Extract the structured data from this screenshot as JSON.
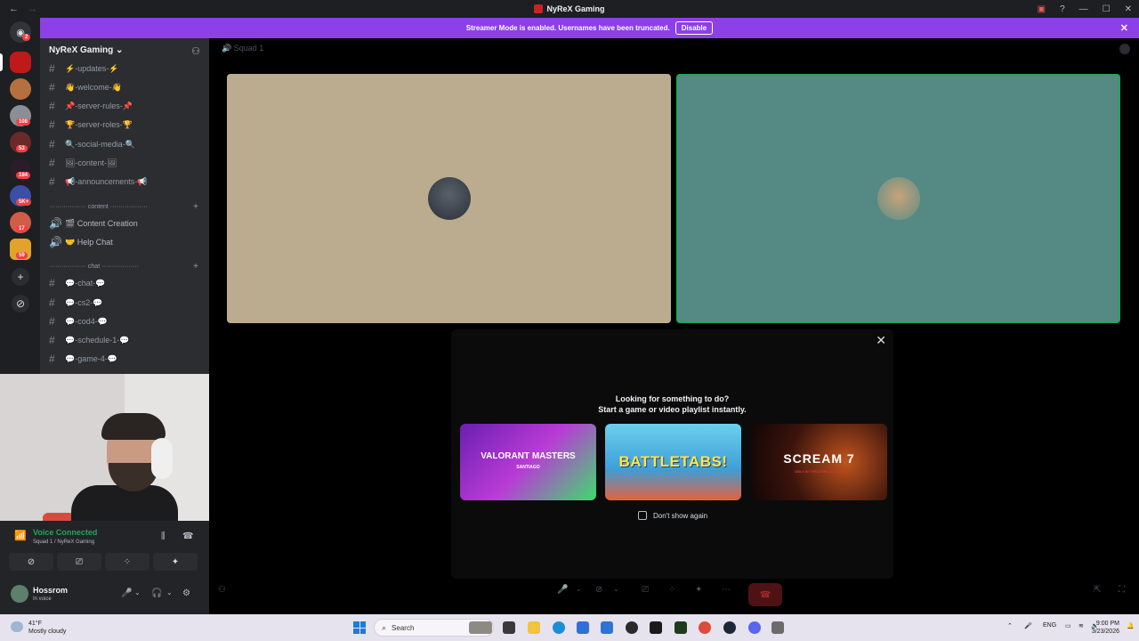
{
  "window": {
    "title": "NyReX Gaming"
  },
  "banner": {
    "text": "Streamer Mode is enabled. Usernames have been truncated.",
    "button": "Disable"
  },
  "rail": {
    "badges": [
      "2",
      "108",
      "53",
      "184",
      "5K+",
      "17",
      "59"
    ]
  },
  "sidebar": {
    "server_name": "NyReX Gaming",
    "channels_top": [
      {
        "label": "⚡-updates-⚡"
      },
      {
        "label": "👋-welcome-👋"
      },
      {
        "label": "📌-server-rules-📌"
      },
      {
        "label": "🏆-server-roles-🏆"
      },
      {
        "label": "🔍-social-media-🔍"
      },
      {
        "label": "🖼-content-🖼"
      },
      {
        "label": "📢-announcements-📢"
      }
    ],
    "category_content": "·················· content ··················",
    "voice_channels": [
      {
        "label": "🎬 Content Creation"
      },
      {
        "label": "🤝 Help Chat"
      }
    ],
    "category_chat": "·················· chat ··················",
    "channels_chat": [
      {
        "label": "💬-chat-💬"
      },
      {
        "label": "💬-cs2-💬"
      },
      {
        "label": "💬-cod4-💬"
      },
      {
        "label": "💬-schedule-1-💬"
      },
      {
        "label": "💬-game-4-💬"
      }
    ]
  },
  "voice_panel": {
    "status": "Voice Connected",
    "location": "Squad 1 / NyReX Gaming",
    "username": "Hossrom",
    "user_status": "In voice"
  },
  "stage": {
    "channel_name": "Squad 1"
  },
  "activity": {
    "line1": "Looking for something to do?",
    "line2": "Start a game or video playlist instantly.",
    "cards": [
      {
        "label": "VALORANT MASTERS",
        "sub": "SANTIAGO"
      },
      {
        "label": "BATTLETABS!"
      },
      {
        "label": "SCREAM 7",
        "sub": "ONLY IN THEATERS 02.27.26"
      }
    ],
    "dont_show": "Don't show again"
  },
  "taskbar": {
    "temp": "41°F",
    "weather": "Mostly cloudy",
    "search": "Search",
    "lang": "ENG",
    "time": "9:00 PM",
    "date": "3/23/2026"
  },
  "colors": {
    "accent": "#8d3fe8",
    "voice_green": "#23a55a",
    "end_call": "#4f1214"
  }
}
